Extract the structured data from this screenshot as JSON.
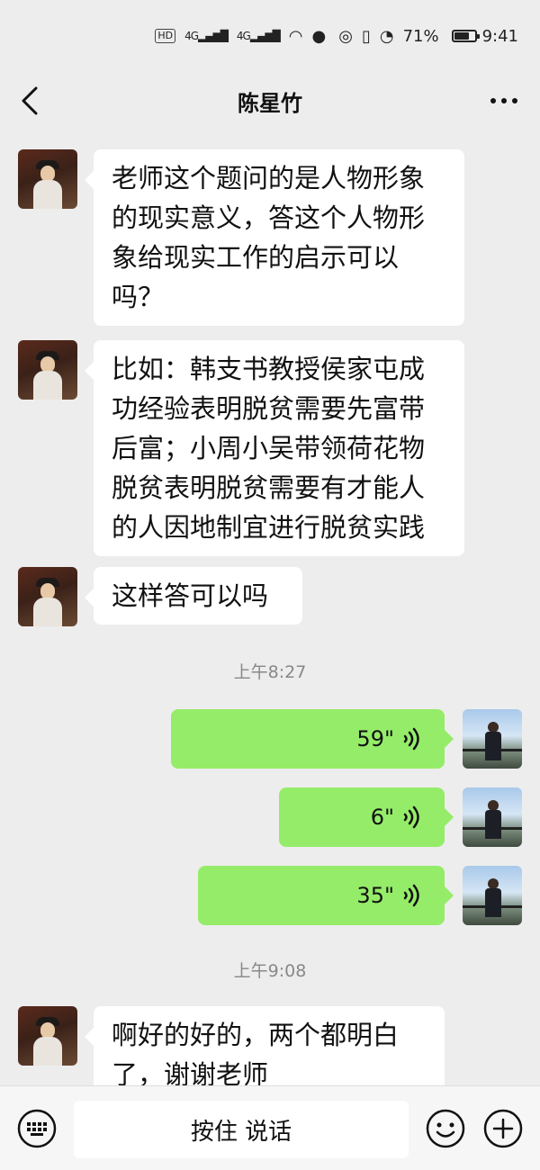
{
  "status": {
    "hd": "HD",
    "sim": "2",
    "net1": "4G",
    "net2": "4G",
    "battery_percent": "71%",
    "battery_level": 0.71,
    "time": "9:41"
  },
  "header": {
    "title": "陈星竹"
  },
  "messages": [
    {
      "side": "left",
      "lines": [
        "老师这个题问的是人物形象",
        "的现实意义，答这个人物形",
        "象给现实工作的启示可以",
        "吗？"
      ]
    },
    {
      "side": "left",
      "lines": [
        "比如：韩支书教授侯家屯成",
        "功经验表明脱贫需要先富带",
        "后富；小周小吴带领荷花物",
        "脱贫表明脱贫需要有才能人",
        "的人因地制宜进行脱贫实践"
      ]
    },
    {
      "side": "left",
      "lines": [
        "这样答可以吗"
      ]
    },
    {
      "type": "time",
      "text": "上午8:27"
    },
    {
      "side": "right",
      "voice": "59\""
    },
    {
      "side": "right",
      "voice": "6\""
    },
    {
      "side": "right",
      "voice": "35\""
    },
    {
      "type": "time",
      "text": "上午9:08"
    },
    {
      "side": "left",
      "lines": [
        "啊好的好的，两个都明白",
        "了，谢谢老师"
      ]
    }
  ],
  "input": {
    "hold_to_talk": "按住 说话"
  },
  "icons": {
    "back": "chevron-left-icon",
    "more": "more-icon",
    "keyboard": "keyboard-icon",
    "emoji": "emoji-icon",
    "plus": "plus-icon",
    "voice_wave": "voice-wave-icon"
  }
}
